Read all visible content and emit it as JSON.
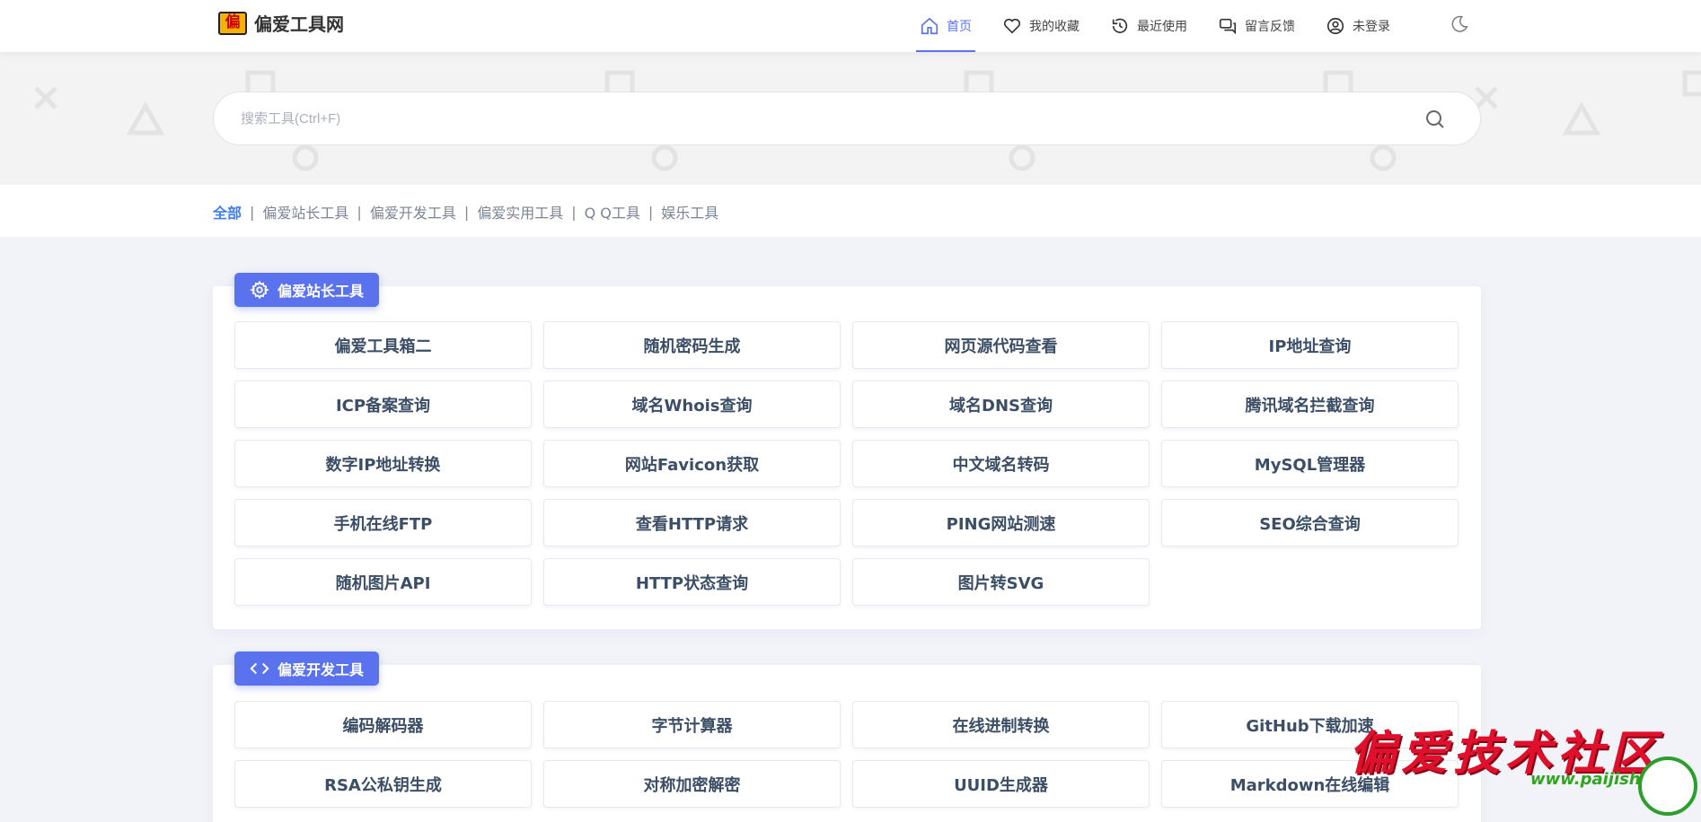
{
  "header": {
    "logo_mark": "偏",
    "logo_text": "偏爱工具网",
    "nav": [
      {
        "label": "首页",
        "icon": "home-icon",
        "active": true
      },
      {
        "label": "我的收藏",
        "icon": "heart-icon",
        "active": false
      },
      {
        "label": "最近使用",
        "icon": "history-icon",
        "active": false
      },
      {
        "label": "留言反馈",
        "icon": "chat-icon",
        "active": false
      },
      {
        "label": "未登录",
        "icon": "user-icon",
        "active": false
      }
    ],
    "theme_toggle_icon": "moon-icon"
  },
  "search": {
    "placeholder": "搜索工具(Ctrl+F)",
    "value": ""
  },
  "filters": {
    "items": [
      "全部",
      "偏爱站长工具",
      "偏爱开发工具",
      "偏爱实用工具",
      "Q Q工具",
      "娱乐工具"
    ],
    "active": "全部",
    "separator": "|"
  },
  "sections": [
    {
      "title": "偏爱站长工具",
      "icon": "gear-icon",
      "tools": [
        "偏爱工具箱二",
        "随机密码生成",
        "网页源代码查看",
        "IP地址查询",
        "ICP备案查询",
        "域名Whois查询",
        "域名DNS查询",
        "腾讯域名拦截查询",
        "数字IP地址转换",
        "网站Favicon获取",
        "中文域名转码",
        "MySQL管理器",
        "手机在线FTP",
        "查看HTTP请求",
        "PING网站测速",
        "SEO综合查询",
        "随机图片API",
        "HTTP状态查询",
        "图片转SVG"
      ]
    },
    {
      "title": "偏爱开发工具",
      "icon": "code-icon",
      "tools": [
        "编码解码器",
        "字节计算器",
        "在线进制转换",
        "GitHub下载加速",
        "RSA公私钥生成",
        "对称加密解密",
        "UUID生成器",
        "Markdown在线编辑"
      ]
    }
  ],
  "watermark": {
    "title": "偏爱技术社区",
    "url": "www.paijishu.com"
  },
  "colors": {
    "accent": "#5b72ee",
    "filter_active": "#3c7df3",
    "page_bg": "#f1f3f8"
  }
}
